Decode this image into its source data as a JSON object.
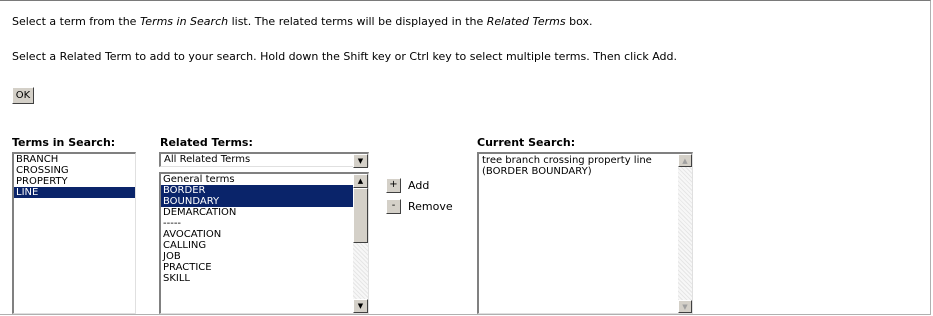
{
  "instructions": {
    "line1_a": "Select a term from the ",
    "line1_b": "Terms in Search",
    "line1_c": " list. The related terms will be displayed in the ",
    "line1_d": "Related Terms",
    "line1_e": " box.",
    "line2": "Select a Related Term to add to your search. Hold down the Shift key or Ctrl key to select multiple terms. Then click Add."
  },
  "ok_button": "OK",
  "terms_in_search": {
    "label": "Terms in Search:",
    "items": [
      {
        "text": "BRANCH",
        "selected": false
      },
      {
        "text": "CROSSING",
        "selected": false
      },
      {
        "text": "PROPERTY",
        "selected": false
      },
      {
        "text": "LINE",
        "selected": true
      }
    ]
  },
  "related_terms": {
    "label": "Related Terms:",
    "filter_value": "All Related Terms",
    "items": [
      {
        "text": "General terms",
        "selected": false
      },
      {
        "text": "BORDER",
        "selected": true
      },
      {
        "text": "BOUNDARY",
        "selected": true
      },
      {
        "text": "DEMARCATION",
        "selected": false
      },
      {
        "text": "-----",
        "selected": false
      },
      {
        "text": "AVOCATION",
        "selected": false
      },
      {
        "text": "CALLING",
        "selected": false
      },
      {
        "text": "JOB",
        "selected": false
      },
      {
        "text": "PRACTICE",
        "selected": false
      },
      {
        "text": "SKILL",
        "selected": false
      }
    ]
  },
  "actions": {
    "add_symbol": "+",
    "add_label": "Add",
    "remove_symbol": "-",
    "remove_label": "Remove"
  },
  "current_search": {
    "label": "Current Search:",
    "value": "tree branch crossing property line (BORDER BOUNDARY)"
  }
}
